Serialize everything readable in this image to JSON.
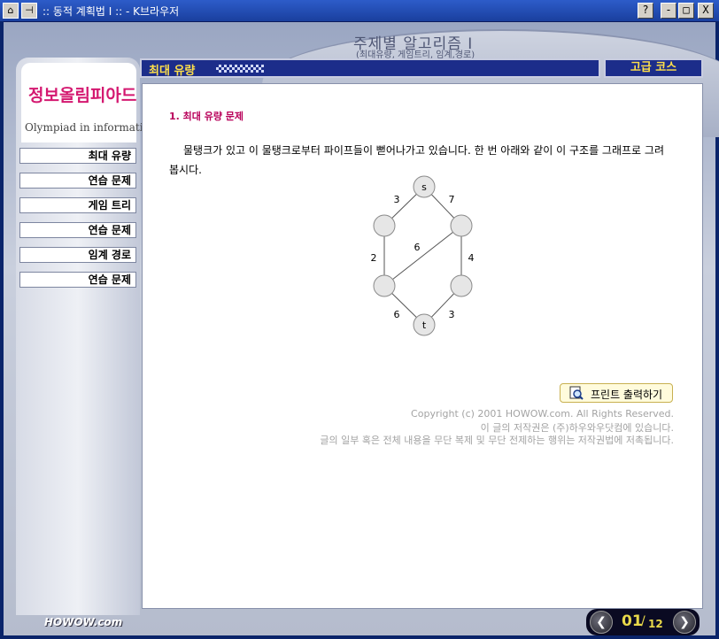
{
  "window": {
    "title": ":: 동적 계획법 I :: - K브라우저",
    "help": "?",
    "minimize": "-",
    "maximize": "□",
    "close": "X"
  },
  "header": {
    "subject_title": "주제별 알고리즘 I",
    "subject_subtitle": "(최대유량, 게임트리, 임계,경로)"
  },
  "logo": {
    "korean": "정보올림피아드",
    "english": "Olympiad in informatics"
  },
  "sidebar": {
    "items": [
      {
        "label": "최대 유량"
      },
      {
        "label": "연습 문제"
      },
      {
        "label": "게임 트리"
      },
      {
        "label": "연습 문제"
      },
      {
        "label": "임계 경로"
      },
      {
        "label": "연습 문제"
      }
    ]
  },
  "section": {
    "title": "최대 유량",
    "level": "고급 코스"
  },
  "content": {
    "problem_title": "1. 최대 유량 문제",
    "problem_text": "물탱크가 있고 이 물탱크로부터 파이프들이 뻗어나가고 있습니다. 한 번 아래와 같이 이 구조를 그래프로 그려봅시다.",
    "graph": {
      "source": "s",
      "sink": "t",
      "weights": [
        "3",
        "7",
        "6",
        "2",
        "4",
        "6",
        "3"
      ]
    },
    "print_button": "프린트 출력하기",
    "copyright": [
      "Copyright (c) 2001 HOWOW.com. All Rights Reserved.",
      "이 글의 저작권은 (주)하우와우닷컴에 있습니다.",
      "글의 일부 혹은 전체 내용을 무단 복제 및 무단 전제하는 행위는 저작권법에 저촉됩니다."
    ]
  },
  "footer": {
    "brand": "HOWOW.com",
    "page_current": "01",
    "page_total": "12"
  }
}
